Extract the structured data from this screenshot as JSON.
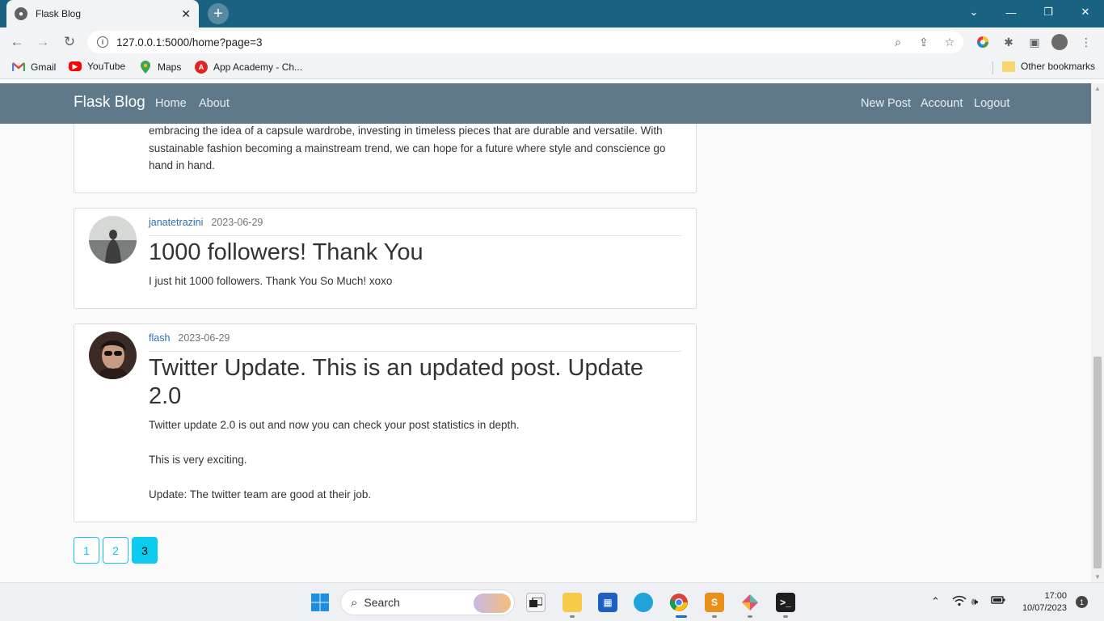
{
  "browser": {
    "tab_title": "Flask Blog",
    "url": "127.0.0.1:5000/home?page=3",
    "bookmarks": [
      {
        "label": "Gmail",
        "icon": "gmail-icon",
        "color": "#ea4335"
      },
      {
        "label": "YouTube",
        "icon": "youtube-icon",
        "color": "#ff0000"
      },
      {
        "label": "Maps",
        "icon": "maps-icon",
        "color": "#34a853"
      },
      {
        "label": "App Academy - Ch...",
        "icon": "app-academy-icon",
        "color": "#e02424"
      }
    ],
    "other_bookmarks": "Other bookmarks"
  },
  "navbar": {
    "brand": "Flask Blog",
    "home": "Home",
    "about": "About",
    "new_post": "New Post",
    "account": "Account",
    "logout": "Logout"
  },
  "posts": [
    {
      "partial_body": "embracing the idea of a capsule wardrobe, investing in timeless pieces that are durable and versatile. With sustainable fashion becoming a mainstream trend, we can hope for a future where style and conscience go hand in hand."
    },
    {
      "author": "janatetrazini",
      "date": "2023-06-29",
      "title": "1000 followers! Thank You",
      "body": "I just hit 1000 followers. Thank You So Much! xoxo"
    },
    {
      "author": "flash",
      "date": "2023-06-29",
      "title": "Twitter Update. This is an updated post. Update 2.0",
      "body_lines": [
        "Twitter update 2.0 is out and now you can check your post statistics in depth.",
        "This is very exciting.",
        "Update: The twitter team are good at their job."
      ]
    }
  ],
  "pagination": {
    "pages": [
      "1",
      "2",
      "3"
    ],
    "current": "3"
  },
  "taskbar": {
    "search_placeholder": "Search",
    "time": "17:00",
    "date": "10/07/2023",
    "notifications": "1"
  },
  "colors": {
    "navbar_bg": "#5f788a",
    "accent_link": "#2b6fb6",
    "pager_accent": "#17c1e8"
  }
}
